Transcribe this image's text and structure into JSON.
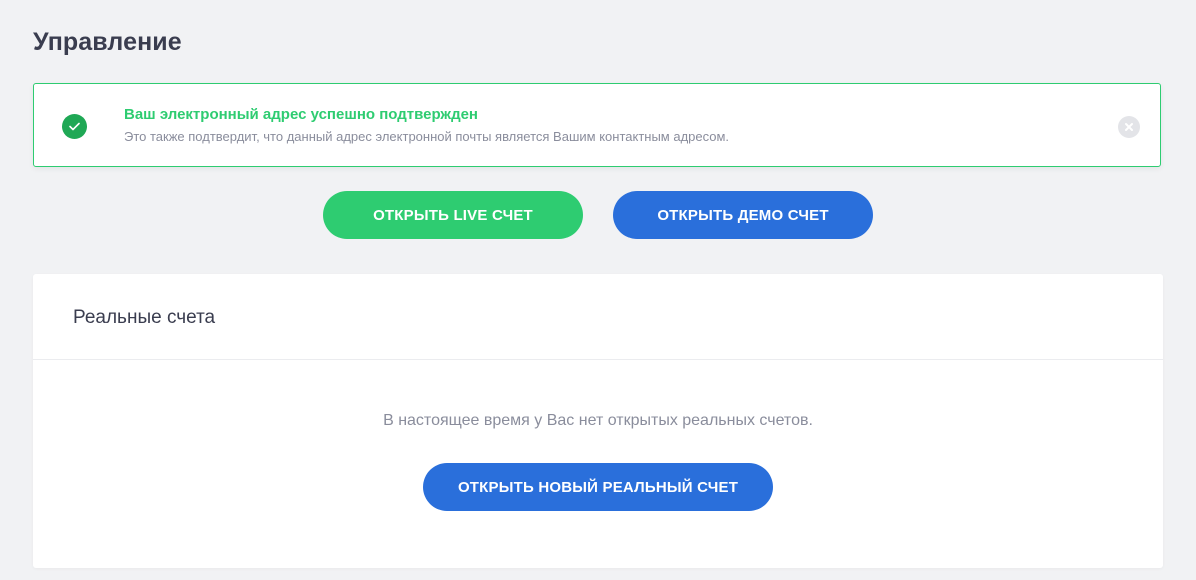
{
  "page": {
    "title": "Управление"
  },
  "alert": {
    "title": "Ваш электронный адрес успешно подтвержден",
    "text": "Это также подтвердит, что данный адрес электронной почты является Вашим контактным адресом.",
    "icon": "check-circle-icon",
    "close_icon": "close-circle-icon",
    "color": "#2ecc71"
  },
  "actions": {
    "live_label": "ОТКРЫТЬ LIVE СЧЕТ",
    "demo_label": "ОТКРЫТЬ ДЕМО СЧЕТ",
    "live_color": "#2ecc71",
    "demo_color": "#2a6fdb"
  },
  "real_accounts": {
    "title": "Реальные счета",
    "empty_text": "В настоящее время у Вас нет открытых реальных счетов.",
    "open_new_label": "ОТКРЫТЬ НОВЫЙ РЕАЛЬНЫЙ СЧЕТ"
  }
}
